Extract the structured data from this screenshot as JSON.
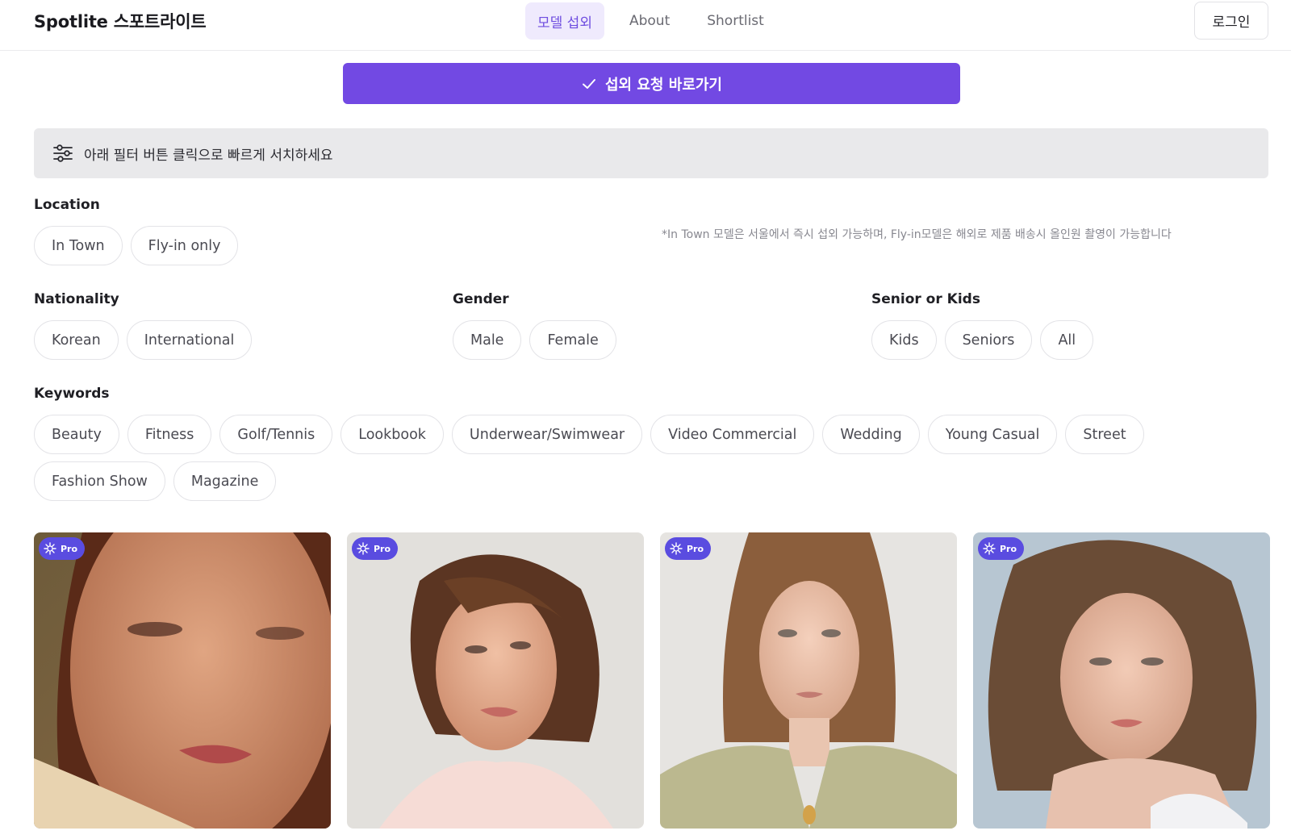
{
  "header": {
    "brand": "Spotlite 스포트라이트",
    "nav": [
      {
        "label": "모델 섭외",
        "active": true
      },
      {
        "label": "About",
        "active": false
      },
      {
        "label": "Shortlist",
        "active": false
      }
    ],
    "login_label": "로그인"
  },
  "cta": {
    "label": "섭외 요청 바로가기",
    "icon": "check-icon"
  },
  "hint": {
    "text": "아래 필터 버튼 클릭으로 빠르게 서치하세요",
    "icon": "sliders-icon"
  },
  "filters": {
    "location": {
      "label": "Location",
      "options": [
        "In Town",
        "Fly-in only"
      ],
      "note": "*In Town 모델은 서울에서 즉시 섭외 가능하며, Fly-in모델은 해외로 제품 배송시 올인원 촬영이 가능합니다"
    },
    "nationality": {
      "label": "Nationality",
      "options": [
        "Korean",
        "International"
      ]
    },
    "gender": {
      "label": "Gender",
      "options": [
        "Male",
        "Female"
      ]
    },
    "senior_kids": {
      "label": "Senior or Kids",
      "options": [
        "Kids",
        "Seniors",
        "All"
      ]
    },
    "keywords": {
      "label": "Keywords",
      "options": [
        "Beauty",
        "Fitness",
        "Golf/Tennis",
        "Lookbook",
        "Underwear/Swimwear",
        "Video Commercial",
        "Wedding",
        "Young Casual",
        "Street",
        "Fashion Show",
        "Magazine"
      ]
    }
  },
  "cards": [
    {
      "badge": "Pro"
    },
    {
      "badge": "Pro"
    },
    {
      "badge": "Pro"
    },
    {
      "badge": "Pro"
    }
  ],
  "colors": {
    "accent": "#7249e3",
    "badge": "#5a4ce0",
    "hint_bg": "#e9e9eb"
  }
}
